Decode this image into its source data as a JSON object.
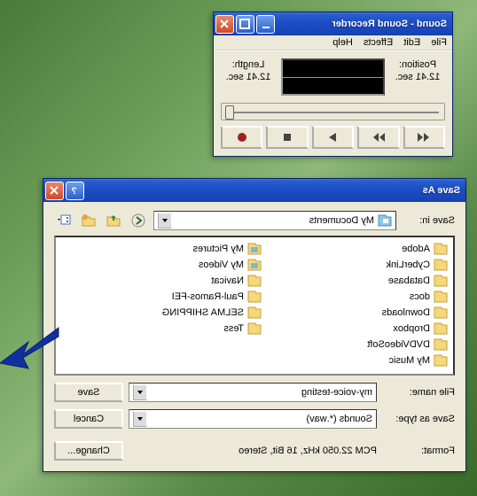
{
  "recorder": {
    "title": "Sound - Sound Recorder",
    "menu": {
      "file": "File",
      "edit": "Edit",
      "effects": "Effects",
      "help": "Help"
    },
    "position_label": "Position:",
    "position_value": "12.41 sec.",
    "length_label": "Length:",
    "length_value": "12.41 sec."
  },
  "saveas": {
    "title": "Save As",
    "savein_label": "Save in:",
    "savein_value": "My Documents",
    "items_col1": [
      "Adobe",
      "CyberLink",
      "Database",
      "docs",
      "Downloads",
      "Dropbox",
      "DVDVideoSoft",
      "My Music"
    ],
    "items_col2": [
      "My Pictures",
      "My Videos",
      "Navicat",
      "Paul-Ramos-FEI",
      "SELMA SHIPPING",
      "Tess"
    ],
    "filename_label": "File name:",
    "filename_value": "my-voice-testing",
    "savetype_label": "Save as type:",
    "savetype_value": "Sounds (*.wav)",
    "format_label": "Format:",
    "format_value": "PCM 22.050 kHz, 16 Bit, Stereo",
    "save_btn": "Save",
    "cancel_btn": "Cancel",
    "change_btn": "Change..."
  }
}
